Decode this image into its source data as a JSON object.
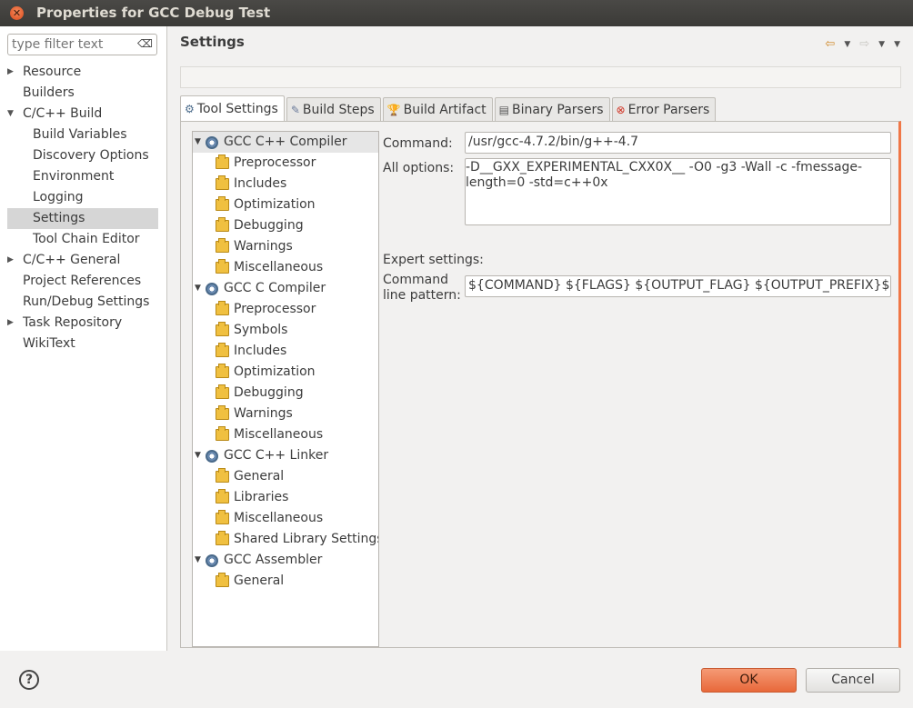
{
  "window": {
    "title": "Properties for GCC Debug Test"
  },
  "filter": {
    "placeholder": "type filter text"
  },
  "nav": [
    {
      "label": "Resource",
      "level": 0,
      "expander": "▶"
    },
    {
      "label": "Builders",
      "level": 0,
      "expander": ""
    },
    {
      "label": "C/C++ Build",
      "level": 0,
      "expander": "▼"
    },
    {
      "label": "Build Variables",
      "level": 1,
      "expander": ""
    },
    {
      "label": "Discovery Options",
      "level": 1,
      "expander": ""
    },
    {
      "label": "Environment",
      "level": 1,
      "expander": ""
    },
    {
      "label": "Logging",
      "level": 1,
      "expander": ""
    },
    {
      "label": "Settings",
      "level": 1,
      "expander": "",
      "selected": true
    },
    {
      "label": "Tool Chain Editor",
      "level": 1,
      "expander": ""
    },
    {
      "label": "C/C++ General",
      "level": 0,
      "expander": "▶"
    },
    {
      "label": "Project References",
      "level": 0,
      "expander": ""
    },
    {
      "label": "Run/Debug Settings",
      "level": 0,
      "expander": ""
    },
    {
      "label": "Task Repository",
      "level": 0,
      "expander": "▶"
    },
    {
      "label": "WikiText",
      "level": 0,
      "expander": ""
    }
  ],
  "page": {
    "title": "Settings"
  },
  "tabs": [
    {
      "label": "Tool Settings",
      "icon": "tool-settings-icon",
      "active": true
    },
    {
      "label": "Build Steps",
      "icon": "build-steps-icon"
    },
    {
      "label": "Build Artifact",
      "icon": "build-artifact-icon"
    },
    {
      "label": "Binary Parsers",
      "icon": "binary-parsers-icon"
    },
    {
      "label": "Error Parsers",
      "icon": "error-parsers-icon"
    }
  ],
  "tool_tree": [
    {
      "label": "GCC C++ Compiler",
      "type": "tool",
      "selected": true
    },
    {
      "label": "Preprocessor",
      "type": "option"
    },
    {
      "label": "Includes",
      "type": "option"
    },
    {
      "label": "Optimization",
      "type": "option"
    },
    {
      "label": "Debugging",
      "type": "option"
    },
    {
      "label": "Warnings",
      "type": "option"
    },
    {
      "label": "Miscellaneous",
      "type": "option"
    },
    {
      "label": "GCC C Compiler",
      "type": "tool"
    },
    {
      "label": "Preprocessor",
      "type": "option"
    },
    {
      "label": "Symbols",
      "type": "option"
    },
    {
      "label": "Includes",
      "type": "option"
    },
    {
      "label": "Optimization",
      "type": "option"
    },
    {
      "label": "Debugging",
      "type": "option"
    },
    {
      "label": "Warnings",
      "type": "option"
    },
    {
      "label": "Miscellaneous",
      "type": "option"
    },
    {
      "label": "GCC C++ Linker",
      "type": "tool"
    },
    {
      "label": "General",
      "type": "option"
    },
    {
      "label": "Libraries",
      "type": "option"
    },
    {
      "label": "Miscellaneous",
      "type": "option"
    },
    {
      "label": "Shared Library Settings",
      "type": "option"
    },
    {
      "label": "GCC Assembler",
      "type": "tool"
    },
    {
      "label": "General",
      "type": "option"
    }
  ],
  "form": {
    "command_label": "Command:",
    "command_value": "/usr/gcc-4.7.2/bin/g++-4.7",
    "all_options_label": "All options:",
    "all_options_line1": "-D__GXX_EXPERIMENTAL_CXX0X__ -O0 -g3 -Wall -c -fmessage-",
    "all_options_line2": "length=0 -std=c++0x",
    "expert_label": "Expert settings:",
    "cmdline_label_1": "Command",
    "cmdline_label_2": "line pattern:",
    "cmdline_value": "${COMMAND} ${FLAGS} ${OUTPUT_FLAG} ${OUTPUT_PREFIX}${OUTPUT} ${INPUTS}"
  },
  "buttons": {
    "ok": "OK",
    "cancel": "Cancel",
    "help": "?"
  },
  "colors": {
    "accent": "#e8683a",
    "titlebar": "#3c3b37"
  }
}
